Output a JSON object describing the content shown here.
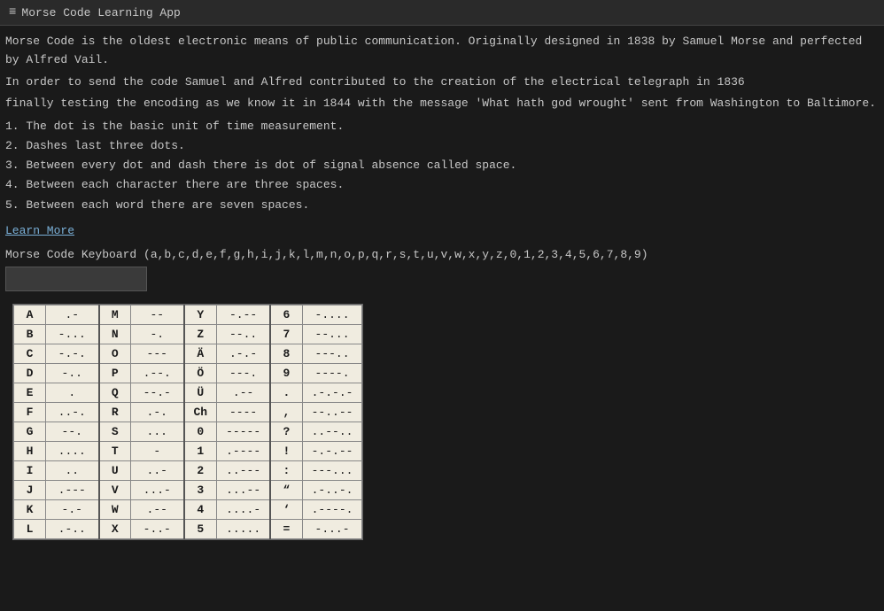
{
  "titlebar": {
    "icon": "≡",
    "title": "Morse Code Learning App"
  },
  "intro": {
    "line1": "Morse Code is the oldest electronic means of public communication. Originally designed in 1838 by Samuel Morse and perfected by Alfred Vail.",
    "line2": "In order to send the code Samuel and Alfred contributed to the creation of the electrical telegraph in 1836",
    "line3": "finally testing the encoding as we know it in 1844 with the message 'What hath god wrought' sent from Washington to Baltimore."
  },
  "rules": [
    "1.  The dot is the basic unit of time measurement.",
    "2.  Dashes last three dots.",
    "3.  Between every dot and dash there is dot of signal absence called space.",
    "4.  Between each character there are three spaces.",
    "5.  Between each word there are seven spaces."
  ],
  "learn_more": "Learn More",
  "keyboard_label": "Morse Code Keyboard (a,b,c,d,e,f,g,h,i,j,k,l,m,n,o,p,q,r,s,t,u,v,w,x,y,z,0,1,2,3,4,5,6,7,8,9)",
  "table": {
    "rows": [
      [
        "A",
        ".-",
        "M",
        "--",
        "Y",
        "-.--",
        "6",
        "-...."
      ],
      [
        "B",
        "-...",
        "N",
        "-.",
        "Z",
        "--..",
        "7",
        "--..."
      ],
      [
        "C",
        "-.-.",
        "O",
        "---",
        "Ä",
        ".-.-",
        "8",
        "---.."
      ],
      [
        "D",
        "-..",
        "P",
        ".--.",
        "Ö",
        "---.",
        "9",
        "----."
      ],
      [
        "E",
        ".",
        "Q",
        "--.-",
        "Ü",
        ".--",
        ".",
        ".-.-.-"
      ],
      [
        "F",
        "..-.",
        "R",
        ".-.",
        "Ch",
        "----",
        ",",
        "--..--"
      ],
      [
        "G",
        "--.",
        "S",
        "...",
        "0",
        "-----",
        "?",
        "..--.."
      ],
      [
        "H",
        "....",
        "T",
        "-",
        "1",
        ".----",
        "!",
        "-.-.--"
      ],
      [
        "I",
        "..",
        "U",
        "..-",
        "2",
        "..---",
        ":",
        "---..."
      ],
      [
        "J",
        ".---",
        "V",
        "...-",
        "3",
        "...--",
        "“",
        ".-..-."
      ],
      [
        "K",
        "-.-",
        "W",
        ".--",
        "4",
        "....-",
        "‘",
        ".----."
      ],
      [
        "L",
        ".-..",
        "X",
        "-..-",
        "5",
        ".....",
        "=",
        "-...-"
      ]
    ]
  }
}
